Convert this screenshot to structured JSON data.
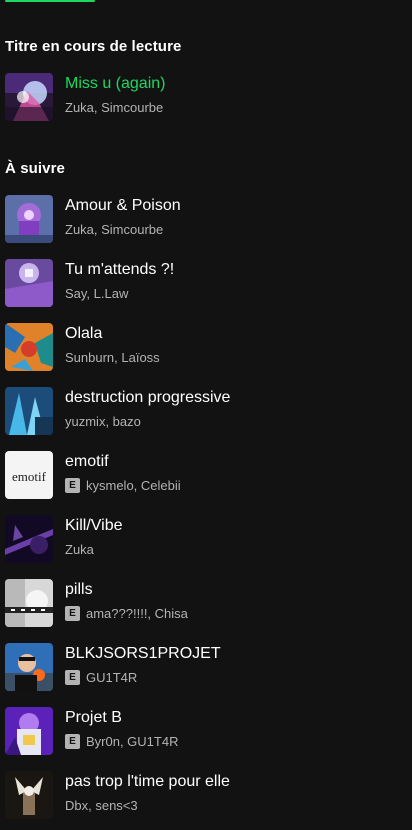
{
  "colors": {
    "background": "#121212",
    "accent": "#1ed760",
    "text_primary": "#ffffff",
    "text_secondary": "#b3b3b3"
  },
  "now_playing": {
    "section_title": "Titre en cours de lecture",
    "track": {
      "title": "Miss u (again)",
      "artists": "Zuka, Simcourbe",
      "explicit": false
    }
  },
  "up_next": {
    "section_title": "À suivre",
    "tracks": [
      {
        "title": "Amour & Poison",
        "artists": "Zuka, Simcourbe",
        "explicit": false
      },
      {
        "title": "Tu m'attends ?!",
        "artists": "Say, L.Law",
        "explicit": false
      },
      {
        "title": "Olala",
        "artists": "Sunburn, Laïoss",
        "explicit": false
      },
      {
        "title": "destruction progressive",
        "artists": "yuzmix, bazo",
        "explicit": false
      },
      {
        "title": "emotif",
        "artists": "kysmelo, Celebii",
        "explicit": true,
        "explicit_label": "E",
        "cover_text": "emotif"
      },
      {
        "title": "Kill/Vibe",
        "artists": "Zuka",
        "explicit": false
      },
      {
        "title": "pills",
        "artists": "ama???!!!!, Chisa",
        "explicit": true,
        "explicit_label": "E"
      },
      {
        "title": "BLKJSORS1PROJET",
        "artists": "GU1T4R",
        "explicit": true,
        "explicit_label": "E"
      },
      {
        "title": "Projet B",
        "artists": "Byr0n, GU1T4R",
        "explicit": true,
        "explicit_label": "E"
      },
      {
        "title": "pas trop l'time pour elle",
        "artists": "Dbx, sens<3",
        "explicit": false
      }
    ]
  }
}
